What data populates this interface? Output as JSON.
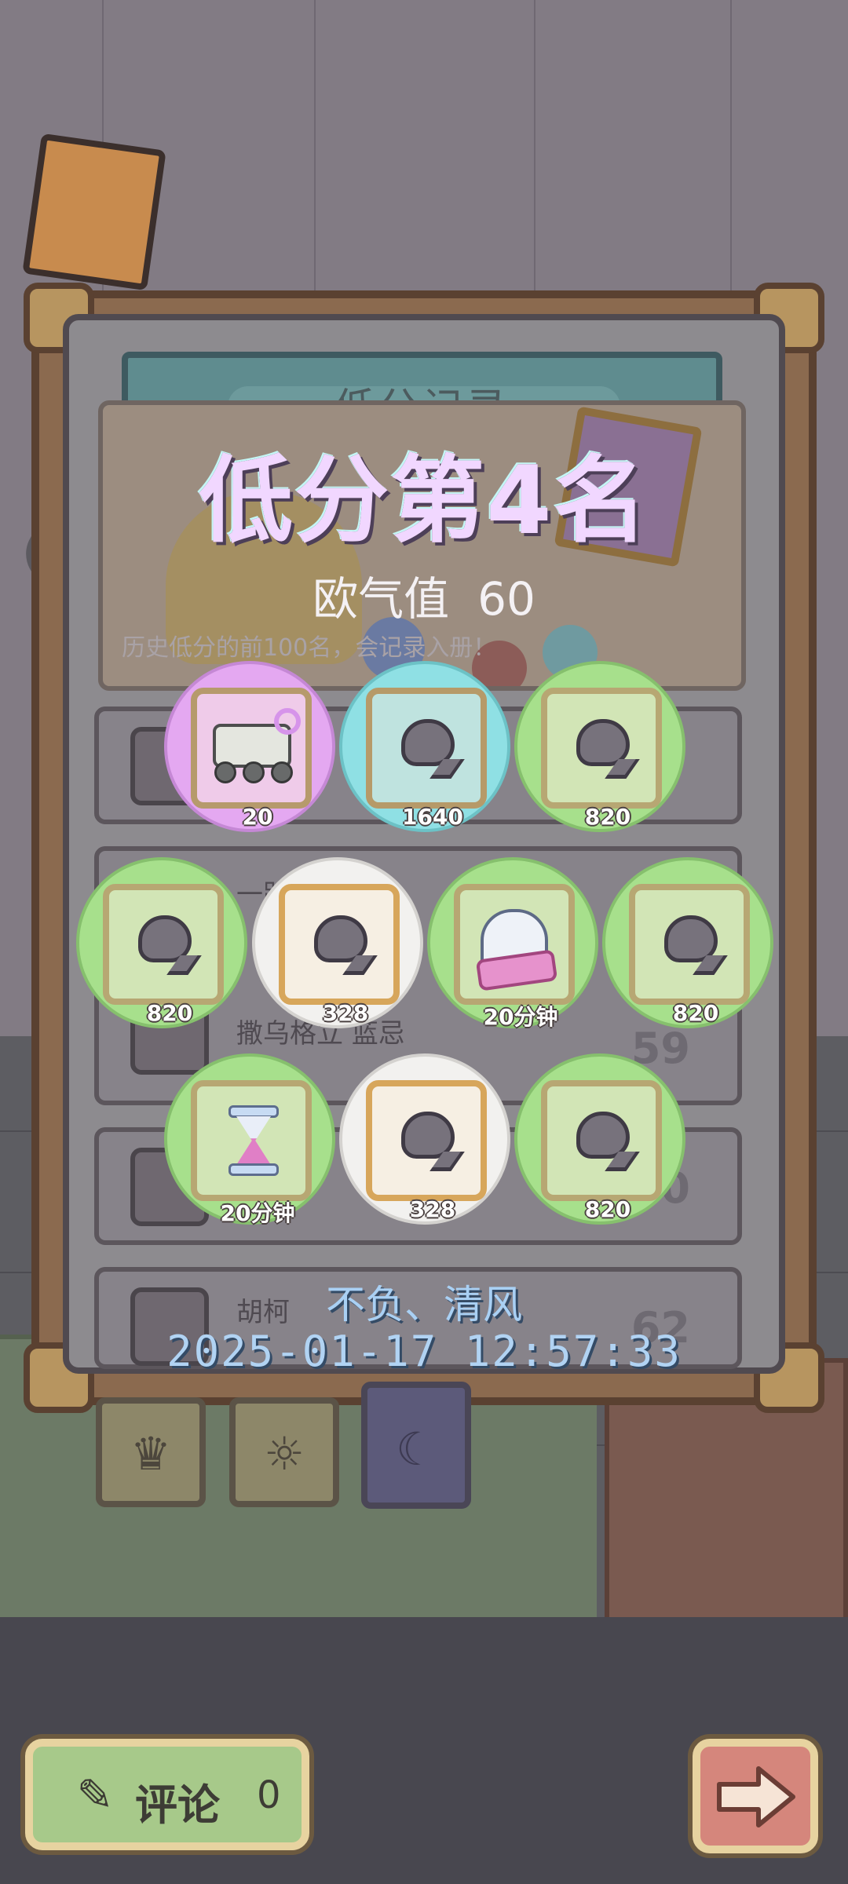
{
  "dialog": {
    "title": "低分记录",
    "rank_text": "低分第4名",
    "luck_label": "欧气值",
    "luck_value": "60",
    "history_note": "历史低分的前100名，会记录入册！"
  },
  "rows_behind": [
    {
      "name": "一路",
      "score": ""
    },
    {
      "name": "撒乌格立 蓝忌",
      "score": "59"
    },
    {
      "name": "",
      "score": "60"
    },
    {
      "name": "胡柯",
      "score": "62"
    }
  ],
  "rewards": [
    {
      "icon": "robot-cart-icon",
      "quantity": "20",
      "rarity": "purple"
    },
    {
      "icon": "spirit-blob-icon",
      "quantity": "1640",
      "rarity": "blue"
    },
    {
      "icon": "spirit-blob-icon",
      "quantity": "820",
      "rarity": "green"
    },
    {
      "icon": "spirit-blob-icon",
      "quantity": "820",
      "rarity": "green"
    },
    {
      "icon": "spirit-blob-icon",
      "quantity": "328",
      "rarity": "white"
    },
    {
      "icon": "ghost-icon",
      "quantity": "20分钟",
      "rarity": "green"
    },
    {
      "icon": "spirit-blob-icon",
      "quantity": "820",
      "rarity": "green"
    },
    {
      "icon": "hourglass-icon",
      "quantity": "20分钟",
      "rarity": "green"
    },
    {
      "icon": "spirit-blob-icon",
      "quantity": "328",
      "rarity": "white"
    },
    {
      "icon": "spirit-blob-icon",
      "quantity": "820",
      "rarity": "green"
    }
  ],
  "player": {
    "name": "不负、清风",
    "timestamp": "2025-01-17 12:57:33"
  },
  "tabs": [
    {
      "icon": "crown-icon",
      "active": false
    },
    {
      "icon": "sun-icon",
      "active": false
    },
    {
      "icon": "moon-icon",
      "active": true
    }
  ],
  "footer": {
    "comment_label": "评论",
    "comment_count": "0",
    "next_icon": "arrow-right-icon"
  },
  "colors": {
    "purple": "#e4a8f1",
    "blue": "#8fe0e4",
    "green": "#a7e08c",
    "white": "#f2f1ef",
    "title_text": "#f1d7ff",
    "player_text": "#a9d0f4"
  }
}
